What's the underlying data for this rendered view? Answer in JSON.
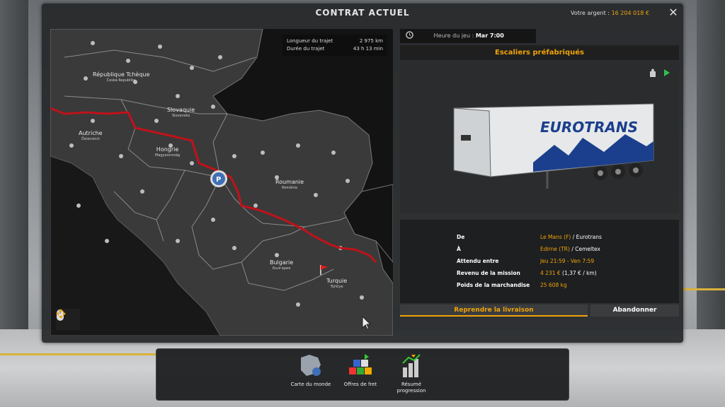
{
  "window": {
    "title": "CONTRAT ACTUEL",
    "money_label": "Votre argent :",
    "money_value": "16 204 018 €"
  },
  "route": {
    "length_label": "Longueur du trajet",
    "length_value": "2 975 km",
    "duration_label": "Durée du trajet",
    "duration_value": "43 h 13 min"
  },
  "map_labels": [
    {
      "name": "République Tchèque",
      "sub": "Česká Republika"
    },
    {
      "name": "Slovaquie",
      "sub": "Slovensko"
    },
    {
      "name": "Autriche",
      "sub": "Österreich"
    },
    {
      "name": "Hongrie",
      "sub": "Magyarország"
    },
    {
      "name": "Roumanie",
      "sub": "România"
    },
    {
      "name": "Bulgarie",
      "sub": "България"
    },
    {
      "name": "Turquie",
      "sub": "Türkiye"
    }
  ],
  "game_time": {
    "label": "Heure du jeu :",
    "value": "Mar 7:00"
  },
  "cargo": {
    "name": "Escaliers préfabriqués",
    "trailer_brand": "EUROTRANS"
  },
  "details": [
    {
      "label": "De",
      "value_orange": "Le Mans (F)",
      "value_white": " / Eurotrans"
    },
    {
      "label": "À",
      "value_orange": "Edirne (TR)",
      "value_white": " / Cemeltex"
    },
    {
      "label": "Attendu entre",
      "value_orange": "Jeu 21:59 - Ven 7:59",
      "value_white": ""
    },
    {
      "label": "Revenu de la mission",
      "value_orange": "4 231 €",
      "value_white": " (1,37 € / km)"
    },
    {
      "label": "Poids de la marchandise",
      "value_orange": "25 608 kg",
      "value_white": ""
    }
  ],
  "buttons": {
    "resume": "Reprendre la livraison",
    "abandon": "Abandonner"
  },
  "bottom": {
    "world_map": "Carte du monde",
    "freight": "Offres de fret",
    "summary": "Résumé progression"
  },
  "colors": {
    "accent": "#f0a30a",
    "route": "#c0121a"
  }
}
